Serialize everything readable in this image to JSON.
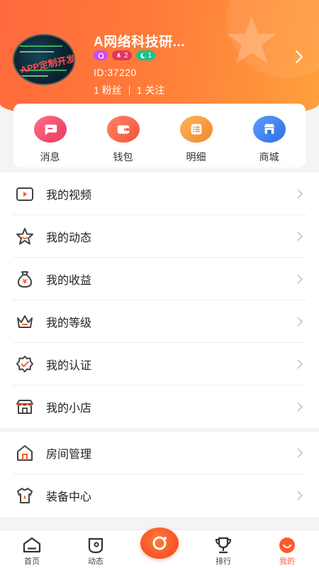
{
  "profile": {
    "name": "A网络科技研...",
    "badges": [
      {
        "icon": "chat-icon",
        "value": "",
        "color": "#c74df0"
      },
      {
        "icon": "mic-icon",
        "value": "2",
        "color": "#e2375f"
      },
      {
        "icon": "moon-icon",
        "value": "1",
        "color": "#1ec08a"
      }
    ],
    "id_text": "ID:37220",
    "fans": "1 粉丝",
    "following": "1 关注",
    "avatar_text": "APP定制开发"
  },
  "quick_actions": [
    {
      "label": "消息",
      "icon": "message-icon",
      "color": "#f0506e"
    },
    {
      "label": "钱包",
      "icon": "wallet-icon",
      "color": "#f46a50"
    },
    {
      "label": "明细",
      "icon": "list-icon",
      "color": "#f59a3c"
    },
    {
      "label": "商城",
      "icon": "store-icon",
      "color": "#3f86ec"
    }
  ],
  "menu_group_1": [
    {
      "label": "我的视频",
      "icon": "video-icon"
    },
    {
      "label": "我的动态",
      "icon": "star-icon"
    },
    {
      "label": "我的收益",
      "icon": "money-bag-icon"
    },
    {
      "label": "我的等级",
      "icon": "crown-icon"
    },
    {
      "label": "我的认证",
      "icon": "verified-icon"
    },
    {
      "label": "我的小店",
      "icon": "shop-icon"
    }
  ],
  "menu_group_2": [
    {
      "label": "房间管理",
      "icon": "house-icon"
    },
    {
      "label": "装备中心",
      "icon": "shirt-icon"
    }
  ],
  "tabs": [
    {
      "label": "首页",
      "icon": "home-icon",
      "active": false
    },
    {
      "label": "动态",
      "icon": "moments-icon",
      "active": false
    },
    {
      "label": "",
      "icon": "live-camera-icon",
      "active": false
    },
    {
      "label": "排行",
      "icon": "trophy-icon",
      "active": false
    },
    {
      "label": "我的",
      "icon": "profile-face-icon",
      "active": true
    }
  ],
  "colors": {
    "accent": "#ff5a2c",
    "header_gradient_start": "#ff6a3d",
    "header_gradient_end": "#ffa03c"
  }
}
